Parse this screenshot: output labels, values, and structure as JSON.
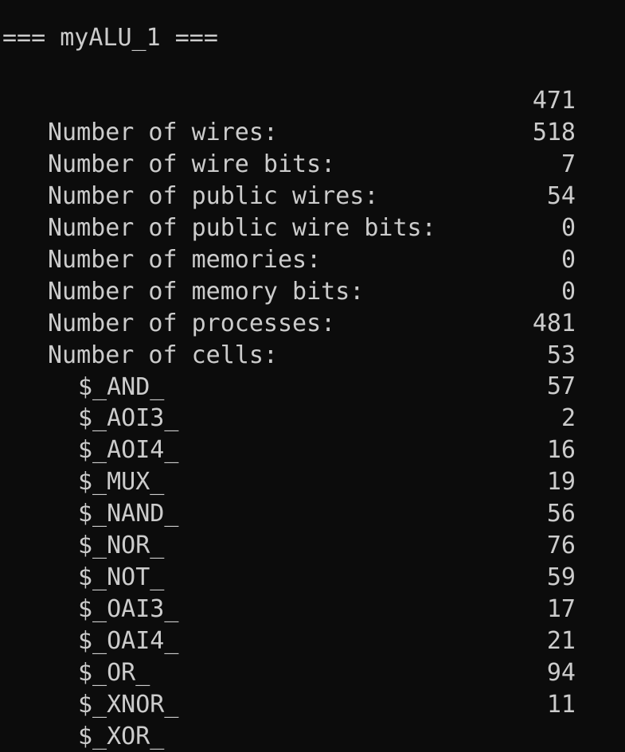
{
  "title": "=== myALU_1 ===",
  "stats": [
    {
      "label": "Number of wires:",
      "value": "471"
    },
    {
      "label": "Number of wire bits:",
      "value": "518"
    },
    {
      "label": "Number of public wires:",
      "value": "7"
    },
    {
      "label": "Number of public wire bits:",
      "value": "54"
    },
    {
      "label": "Number of memories:",
      "value": "0"
    },
    {
      "label": "Number of memory bits:",
      "value": "0"
    },
    {
      "label": "Number of processes:",
      "value": "0"
    },
    {
      "label": "Number of cells:",
      "value": "481"
    }
  ],
  "cells": [
    {
      "label": "$_AND_",
      "value": "53"
    },
    {
      "label": "$_AOI3_",
      "value": "57"
    },
    {
      "label": "$_AOI4_",
      "value": "2"
    },
    {
      "label": "$_MUX_",
      "value": "16"
    },
    {
      "label": "$_NAND_",
      "value": "19"
    },
    {
      "label": "$_NOR_",
      "value": "56"
    },
    {
      "label": "$_NOT_",
      "value": "76"
    },
    {
      "label": "$_OAI3_",
      "value": "59"
    },
    {
      "label": "$_OAI4_",
      "value": "17"
    },
    {
      "label": "$_OR_",
      "value": "21"
    },
    {
      "label": "$_XNOR_",
      "value": "94"
    },
    {
      "label": "$_XOR_",
      "value": "11"
    }
  ]
}
